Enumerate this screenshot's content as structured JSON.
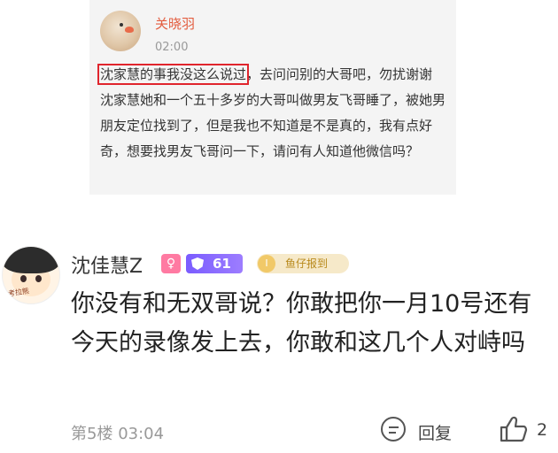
{
  "quote": {
    "author": "关晓羽",
    "time": "02:00",
    "highlighted_text": "沈家慧的事我没这么说过",
    "rest_text": "，去问问别的大哥吧，勿扰谢谢 沈家慧她和一个五十多岁的大哥叫做男友飞哥睡了，被她男朋友定位找到了，但是我也不知道是不是真的，我有点好奇，想要找男友飞哥问一下，请问有人知道他微信吗？"
  },
  "comment": {
    "username": "沈佳慧Z",
    "gender_icon": "♀",
    "level": "61",
    "tag": "鱼仔报到",
    "tag_icon_text": "I",
    "avatar_stamp": "考拉熊",
    "text": "你没有和无双哥说？你敢把你一月10号还有今天的录像发上去，你敢和这几个人对峙吗",
    "floor": "第5楼",
    "time": "03:04",
    "reply_label": "回复",
    "like_count": "2"
  },
  "colors": {
    "highlight_border": "#e0252d",
    "quote_name": "#e35d3f",
    "level_badge": "#7a5cff",
    "tag_badge_bg": "#f6e9c9"
  },
  "icons": [
    "quote-avatar",
    "gender-female-icon",
    "level-shield-icon",
    "reply-icon",
    "thumbs-up-icon"
  ]
}
